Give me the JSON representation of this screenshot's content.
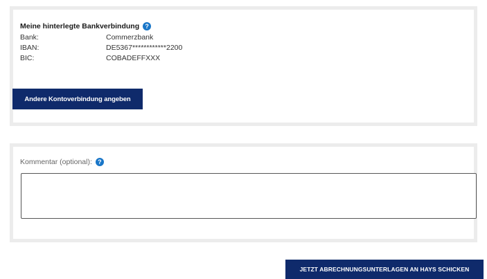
{
  "bank": {
    "title": "Meine hinterlegte Bankverbindung",
    "help_icon": "?",
    "rows": [
      {
        "label": "Bank:",
        "value": "Commerzbank"
      },
      {
        "label": "IBAN:",
        "value": "DE5367************2200"
      },
      {
        "label": "BIC:",
        "value": "COBADEFFXXX"
      }
    ],
    "change_button_label": "Andere Kontoverbindung angeben"
  },
  "comment": {
    "label": "Kommentar (optional):",
    "help_icon": "?",
    "value": ""
  },
  "submit_button_label": "JETZT ABRECHNUNGSUNTERLAGEN AN HAYS SCHICKEN",
  "colors": {
    "button_bg": "#0f2a6b",
    "help_icon_bg": "#1976c8",
    "card_border": "#ececec"
  }
}
